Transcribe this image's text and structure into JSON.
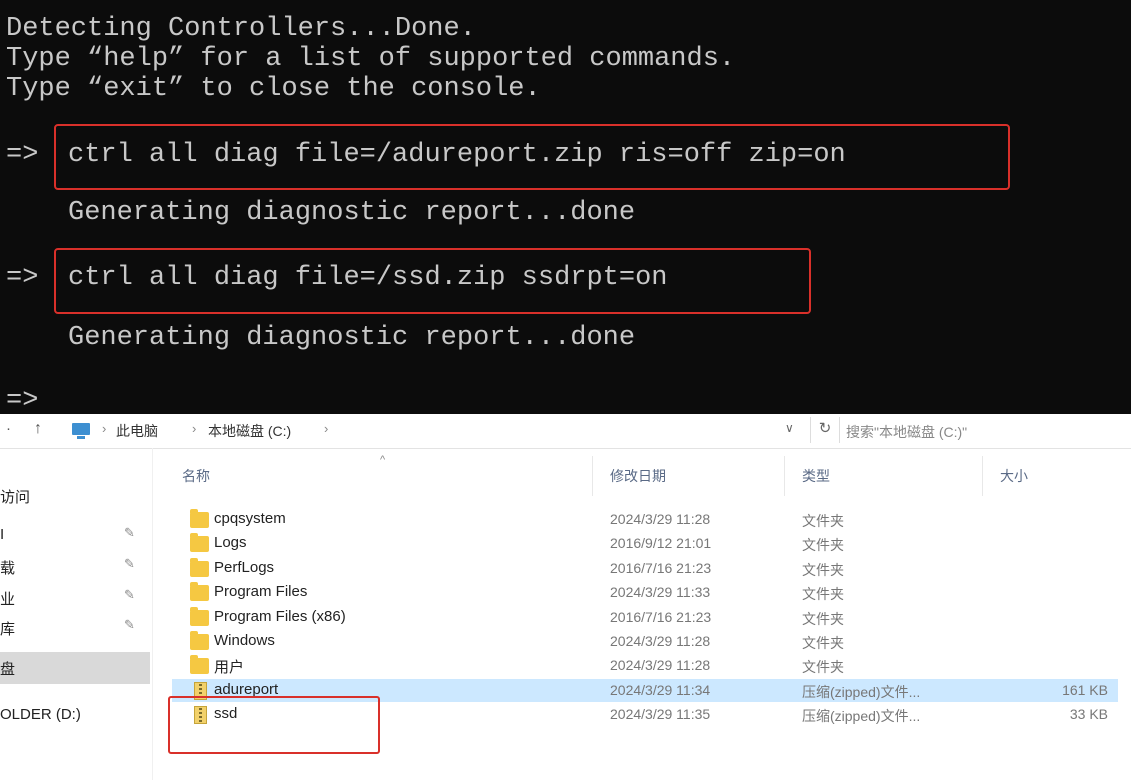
{
  "console": {
    "lines": [
      "Detecting Controllers...Done.",
      "Type “help” for a list of supported commands.",
      "Type “exit” to close the console."
    ],
    "prompt": "=>",
    "cmd1": "ctrl all diag file=/adureport.zip ris=off zip=on",
    "out1": "Generating diagnostic report...done",
    "cmd2": "ctrl all diag file=/ssd.zip ssdrpt=on",
    "out2": "Generating diagnostic report...done",
    "prompt_last": "=>"
  },
  "explorer": {
    "nav": {
      "back": "↑",
      "up": "↑"
    },
    "breadcrumb": [
      "此电脑",
      "本地磁盘 (C:)"
    ],
    "search_placeholder": "搜索\"本地磁盘 (C:)\"",
    "sidebar": [
      {
        "label": "访问",
        "pinned": false
      },
      {
        "label": "I",
        "pinned": true
      },
      {
        "label": "载",
        "pinned": true
      },
      {
        "label": "业",
        "pinned": true
      },
      {
        "label": "库",
        "pinned": true
      },
      {
        "label": "盘",
        "pinned": false
      },
      {
        "label": "OLDER (D:)",
        "pinned": false
      }
    ],
    "columns": {
      "name": "名称",
      "date": "修改日期",
      "type": "类型",
      "size": "大小"
    },
    "files": [
      {
        "name": "cpqsystem",
        "date": "2024/3/29 11:28",
        "type": "文件夹",
        "size": "",
        "icon": "folder-icon"
      },
      {
        "name": "Logs",
        "date": "2016/9/12 21:01",
        "type": "文件夹",
        "size": "",
        "icon": "folder-icon"
      },
      {
        "name": "PerfLogs",
        "date": "2016/7/16 21:23",
        "type": "文件夹",
        "size": "",
        "icon": "folder-icon"
      },
      {
        "name": "Program Files",
        "date": "2024/3/29 11:33",
        "type": "文件夹",
        "size": "",
        "icon": "folder-icon"
      },
      {
        "name": "Program Files (x86)",
        "date": "2016/7/16 21:23",
        "type": "文件夹",
        "size": "",
        "icon": "folder-icon"
      },
      {
        "name": "Windows",
        "date": "2024/3/29 11:28",
        "type": "文件夹",
        "size": "",
        "icon": "folder-icon"
      },
      {
        "name": "用户",
        "date": "2024/3/29 11:28",
        "type": "文件夹",
        "size": "",
        "icon": "folder-icon"
      },
      {
        "name": "adureport",
        "date": "2024/3/29 11:34",
        "type": "压缩(zipped)文件...",
        "size": "161 KB",
        "icon": "zip-icon"
      },
      {
        "name": "ssd",
        "date": "2024/3/29 11:35",
        "type": "压缩(zipped)文件...",
        "size": "33 KB",
        "icon": "zip-icon"
      }
    ]
  },
  "colors": {
    "highlight_box": "#d9302a",
    "selection": "#cce8ff",
    "console_bg": "#0c0c0c"
  }
}
